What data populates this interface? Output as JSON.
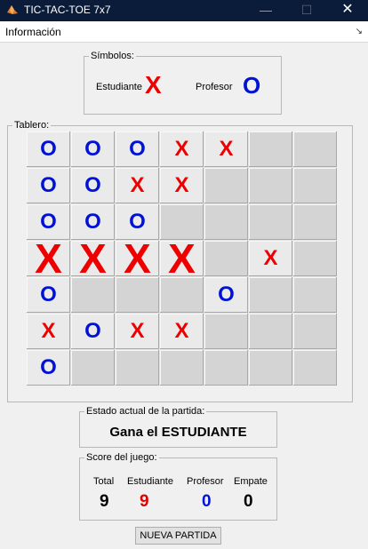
{
  "window": {
    "title": "TIC-TAC-TOE 7x7",
    "icon": "matlab-icon"
  },
  "menu": {
    "items": [
      "Información"
    ],
    "corner_icon": "arrow-icon"
  },
  "symbols": {
    "legend": "Símbolos:",
    "student_label": "Estudiante",
    "student_symbol": "X",
    "teacher_label": "Profesor",
    "teacher_symbol": "O"
  },
  "board": {
    "legend": "Tablero:",
    "rows": [
      [
        "O",
        "O",
        "O",
        "X",
        "X",
        "",
        ""
      ],
      [
        "O",
        "O",
        "X",
        "X",
        "",
        "",
        ""
      ],
      [
        "O",
        "O",
        "O",
        "",
        "",
        "",
        ""
      ],
      [
        "X",
        "X",
        "X",
        "X",
        "",
        "X",
        ""
      ],
      [
        "O",
        "",
        "",
        "",
        "O",
        "",
        ""
      ],
      [
        "X",
        "O",
        "X",
        "X",
        "",
        "",
        ""
      ],
      [
        "O",
        "",
        "",
        "",
        "",
        "",
        ""
      ]
    ],
    "winning_row": 3
  },
  "status": {
    "legend": "Estado actual de la partida:",
    "text": "Gana el ESTUDIANTE"
  },
  "score": {
    "legend": "Score del juego:",
    "headers": [
      "Total",
      "Estudiante",
      "Profesor",
      "Empate"
    ],
    "values": [
      "9",
      "9",
      "0",
      "0"
    ],
    "colors": [
      "#000000",
      "#e00000",
      "#0012d6",
      "#000000"
    ]
  },
  "new_game_label": "NUEVA PARTIDA",
  "colors": {
    "x": "#e00000",
    "o": "#0012d6",
    "titlebar": "#0b1b3a"
  }
}
